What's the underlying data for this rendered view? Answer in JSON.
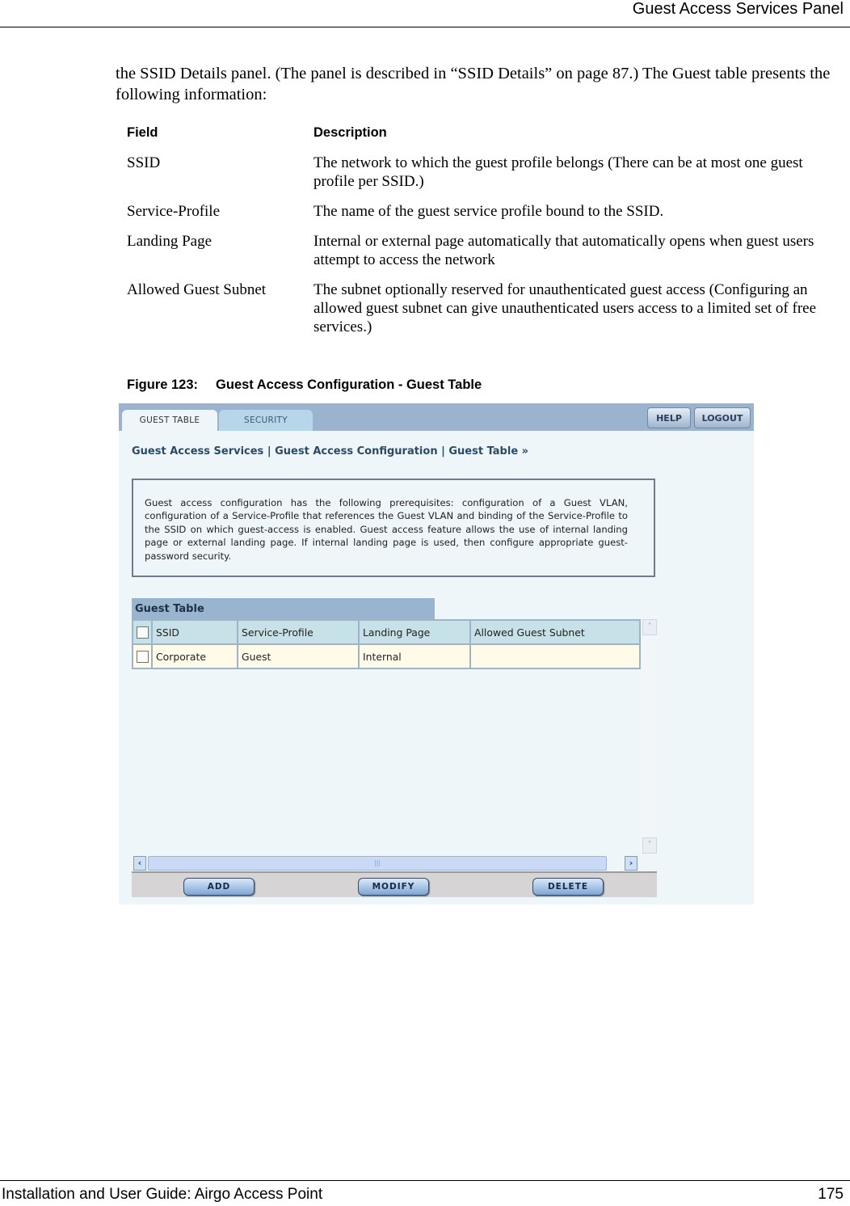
{
  "header": {
    "title": "Guest Access Services Panel"
  },
  "intro": "the SSID Details panel. (The panel is described in “SSID Details” on page 87.) The Guest table presents the following information:",
  "field_table": {
    "headers": {
      "field": "Field",
      "description": "Description"
    },
    "rows": [
      {
        "field": "SSID",
        "description": "The network to which the guest profile belongs (There can be at most one guest profile per SSID.)"
      },
      {
        "field": "Service-Profile",
        "description": "The name of the guest service profile bound to the SSID."
      },
      {
        "field": "Landing Page",
        "description": "Internal or external page automatically that automatically opens when guest users attempt to access the network"
      },
      {
        "field": "Allowed Guest Subnet",
        "description": "The subnet optionally reserved for unauthenticated guest access (Configuring an allowed guest subnet can give unauthenticated users access to a limited set of free services.)"
      }
    ]
  },
  "figure": {
    "number": "Figure 123:",
    "title": "Guest Access Configuration - Guest Table"
  },
  "screenshot": {
    "tabs": [
      {
        "label": "GUEST TABLE",
        "active": true
      },
      {
        "label": "SECURITY",
        "active": false
      }
    ],
    "help_label": "HELP",
    "logout_label": "LOGOUT",
    "breadcrumb": "Guest Access Services | Guest Access Configuration | Guest Table  »",
    "info_text": "Guest access configuration has the following prerequisites: configuration of a Guest VLAN, configuration of a Service-Profile that references the Guest VLAN and binding of the Service-Profile to the SSID on which guest-access is enabled. Guest access feature allows the use of internal landing page or external landing page. If internal landing page is used, then configure appropriate guest-password security.",
    "guest_table": {
      "title": "Guest Table",
      "columns": [
        "SSID",
        "Service-Profile",
        "Landing Page",
        "Allowed Guest Subnet"
      ],
      "rows": [
        [
          "Corporate",
          "Guest",
          "Internal",
          ""
        ]
      ]
    },
    "buttons": {
      "add": "ADD",
      "modify": "MODIFY",
      "delete": "DELETE"
    },
    "scroll_glyphs": {
      "up": "˄",
      "down": "˅",
      "left": "‹",
      "right": "›",
      "grip": "|||"
    }
  },
  "footer": {
    "left": "Installation and User Guide: Airgo Access Point",
    "page": "175"
  }
}
